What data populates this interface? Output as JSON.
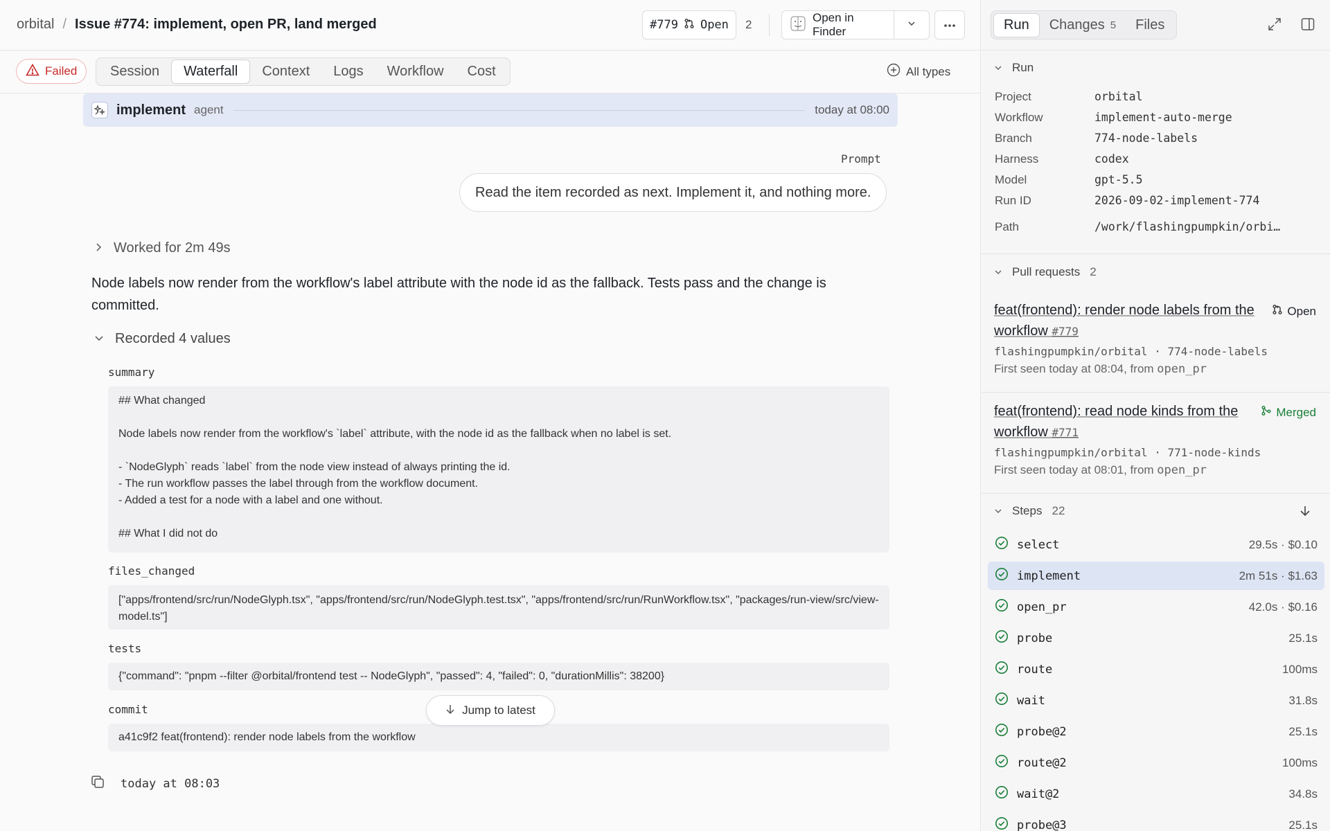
{
  "header": {
    "project": "orbital",
    "separator": "/",
    "title": "Issue #774: implement, open PR, land merged",
    "pr_number": "#779",
    "pr_state": "Open",
    "pr_count": "2",
    "open_in_finder": "Open in Finder"
  },
  "tabs_bar": {
    "status": "Failed",
    "tabs": [
      "Session",
      "Waterfall",
      "Context",
      "Logs",
      "Workflow",
      "Cost"
    ],
    "active_tab": "Waterfall",
    "filter": "All types"
  },
  "agent": {
    "name": "implement",
    "kind": "agent",
    "time": "today at 08:00"
  },
  "prompt": {
    "label": "Prompt",
    "text": "Read the item recorded as next. Implement it, and nothing more."
  },
  "worked": "Worked for 2m 49s",
  "message": "Node labels now render from the workflow's label attribute with the node id as the fallback. Tests pass and the change is committed.",
  "recorded": {
    "header": "Recorded 4 values",
    "summary_label": "summary",
    "summary_lines": [
      "## What changed",
      "",
      "Node labels now render from the workflow's `label` attribute, with the node id as the fallback when no label is set.",
      "",
      "- `NodeGlyph` reads `label` from the node view instead of always printing the id.",
      "- The run workflow passes the label through from the workflow document.",
      "- Added a test for a node with a label and one without.",
      "",
      "## What I did not do"
    ],
    "files_label": "files_changed",
    "files_value": "[\"apps/frontend/src/run/NodeGlyph.tsx\", \"apps/frontend/src/run/NodeGlyph.test.tsx\", \"apps/frontend/src/run/RunWorkflow.tsx\", \"packages/run-view/src/view-model.ts\"]",
    "tests_label": "tests",
    "tests_value": "{\"command\": \"pnpm --filter @orbital/frontend test -- NodeGlyph\", \"passed\": 4, \"failed\": 0, \"durationMillis\": 38200}",
    "commit_label": "commit",
    "commit_value": "a41c9f2 feat(frontend): render node labels from the workflow"
  },
  "footer": {
    "timestamp": "today at 08:03",
    "jump": "Jump to latest"
  },
  "sidebar": {
    "tabs": [
      {
        "label": "Run",
        "count": ""
      },
      {
        "label": "Changes",
        "count": "5"
      },
      {
        "label": "Files",
        "count": ""
      }
    ],
    "run_section": "Run",
    "run_fields": [
      {
        "key": "Project",
        "value": "orbital"
      },
      {
        "key": "Workflow",
        "value": "implement-auto-merge"
      },
      {
        "key": "Branch",
        "value": "774-node-labels"
      },
      {
        "key": "Harness",
        "value": "codex"
      },
      {
        "key": "Model",
        "value": "gpt-5.5"
      },
      {
        "key": "Run ID",
        "value": "2026-09-02-implement-774"
      },
      {
        "key": "Path",
        "value": "/work/flashingpumpkin/orbi…"
      }
    ],
    "pr_section": "Pull requests",
    "pr_count": "2",
    "pull_requests": [
      {
        "title": "feat(frontend): render node labels from the workflow",
        "number": "#779",
        "status": "Open",
        "repo": "flashingpumpkin/orbital · 774-node-labels",
        "seen": "First seen today at 08:04, from ",
        "seen_tool": "open_pr"
      },
      {
        "title": "feat(frontend): read node kinds from the workflow",
        "number": "#771",
        "status": "Merged",
        "repo": "flashingpumpkin/orbital · 771-node-kinds",
        "seen": "First seen today at 08:01, from ",
        "seen_tool": "open_pr"
      }
    ],
    "steps_section": "Steps",
    "steps_count": "22",
    "steps": [
      {
        "name": "select",
        "meta": "29.5s · $0.10"
      },
      {
        "name": "implement",
        "meta": "2m 51s · $1.63"
      },
      {
        "name": "open_pr",
        "meta": "42.0s · $0.16"
      },
      {
        "name": "probe",
        "meta": "25.1s"
      },
      {
        "name": "route",
        "meta": "100ms"
      },
      {
        "name": "wait",
        "meta": "31.8s"
      },
      {
        "name": "probe@2",
        "meta": "25.1s"
      },
      {
        "name": "route@2",
        "meta": "100ms"
      },
      {
        "name": "wait@2",
        "meta": "34.8s"
      },
      {
        "name": "probe@3",
        "meta": "25.1s"
      }
    ],
    "selected_step": "implement"
  },
  "colors": {
    "failed": "#c62828",
    "open": "#1f2328",
    "merged": "#1a7f37",
    "step_ok": "#1a7f37",
    "selection": "#dde4f4"
  }
}
